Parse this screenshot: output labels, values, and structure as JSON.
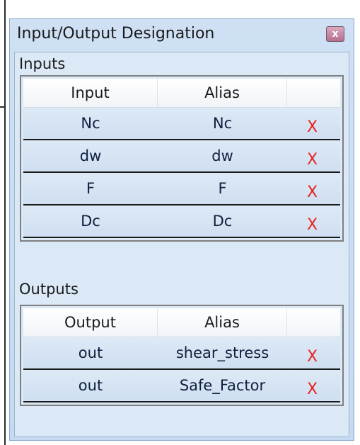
{
  "dialog": {
    "title": "Input/Output Designation",
    "close_symbol": "x"
  },
  "inputs": {
    "label": "Inputs",
    "headers": [
      "Input",
      "Alias",
      ""
    ],
    "rows": [
      {
        "name": "Nc",
        "alias": "Nc",
        "delete": "X"
      },
      {
        "name": "dw",
        "alias": "dw",
        "delete": "X"
      },
      {
        "name": "F",
        "alias": "F",
        "delete": "X"
      },
      {
        "name": "Dc",
        "alias": "Dc",
        "delete": "X"
      }
    ]
  },
  "outputs": {
    "label": "Outputs",
    "headers": [
      "Output",
      "Alias",
      ""
    ],
    "rows": [
      {
        "name": "out",
        "alias": "shear_stress",
        "delete": "X"
      },
      {
        "name": "out",
        "alias": "Safe_Factor",
        "delete": "X"
      }
    ]
  },
  "colors": {
    "delete": "#e8231f",
    "panel": "#dbe8f6",
    "frame": "#c5d9f0"
  }
}
